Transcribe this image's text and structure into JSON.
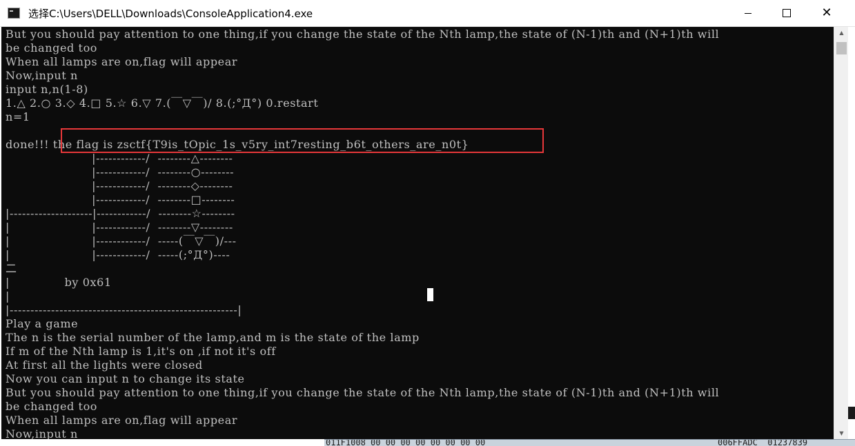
{
  "window": {
    "title": "选择C:\\Users\\DELL\\Downloads\\ConsoleApplication4.exe",
    "icon": "console-app-icon",
    "controls": {
      "minimize": "minimize-icon",
      "maximize": "maximize-icon",
      "close": "✕"
    }
  },
  "console": {
    "background": "#0c0c0c",
    "text_color": "#c0c0c0",
    "highlight_color": "#e8383a",
    "lines": [
      "But you should pay attention to one thing,if you change the state of the Nth lamp,the state of (N-1)th and (N+1)th will",
      "be changed too",
      "When all lamps are on,flag will appear",
      "Now,input n",
      "input n,n(1-8)",
      "1.△ 2.○ 3.◇ 4.□ 5.☆ 6.▽ 7.(￣▽￣)/ 8.(;°Д°) 0.restart",
      "n=1",
      "",
      "done!!! the flag is zsctf{T9is_tOpic_1s_v5ry_int7resting_b6t_others_are_n0t}",
      "                      |------------/  --------△--------",
      "                      |------------/  --------○--------",
      "                      |------------/  --------◇--------",
      "                      |------------/  --------□--------",
      "|--------------------|------------/  --------☆--------",
      "|                     |------------/  --------▽--------",
      "|                     |------------/  -----(￣▽￣)/---",
      "|                     |------------/  -----(;°Д°)----",
      "二",
      "|              by 0x61",
      "|",
      "|-------------------------------------------------------|",
      "Play a game",
      "The n is the serial number of the lamp,and m is the state of the lamp",
      "If m of the Nth lamp is 1,it's on ,if not it's off",
      "At first all the lights were closed",
      "Now you can input n to change its state",
      "But you should pay attention to one thing,if you change the state of the Nth lamp,the state of (N-1)th and (N+1)th will",
      "be changed too",
      "When all lamps are on,flag will appear",
      "Now,input n"
    ]
  },
  "scrollbar": {
    "up_arrow": "▲",
    "down_arrow": "▼"
  },
  "background_window": {
    "left_text": "011F1008 00 00 00 00 00 00 00 00",
    "right_text": "006FFADC  01237839"
  }
}
